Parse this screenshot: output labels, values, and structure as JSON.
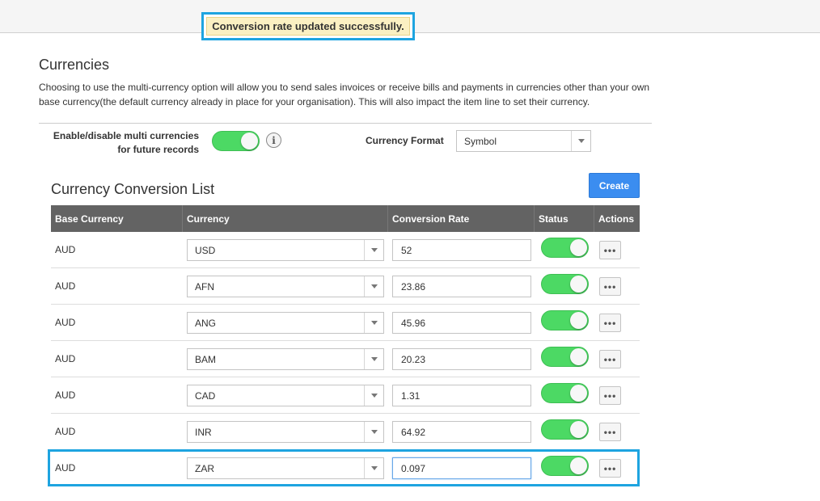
{
  "notification": {
    "message": "Conversion rate updated successfully."
  },
  "page": {
    "title": "Currencies",
    "description": "Choosing to use the multi-currency option will allow you to send sales invoices or receive bills and payments in currencies other than your own base currency(the default currency already in place for your organisation). This will also impact the item line to set their currency."
  },
  "options": {
    "multi_currency_label_line1": "Enable/disable multi currencies",
    "multi_currency_label_line2": "for future records",
    "multi_currency_enabled": true,
    "info_glyph": "i",
    "currency_format_label": "Currency Format",
    "currency_format_value": "Symbol"
  },
  "conversion_list": {
    "title": "Currency Conversion List",
    "create_label": "Create",
    "columns": {
      "base_currency": "Base Currency",
      "currency": "Currency",
      "conversion_rate": "Conversion Rate",
      "status": "Status",
      "actions": "Actions"
    },
    "rows": [
      {
        "base": "AUD",
        "currency": "USD",
        "rate": "52",
        "active": true
      },
      {
        "base": "AUD",
        "currency": "AFN",
        "rate": "23.86",
        "active": true
      },
      {
        "base": "AUD",
        "currency": "ANG",
        "rate": "45.96",
        "active": true
      },
      {
        "base": "AUD",
        "currency": "BAM",
        "rate": "20.23",
        "active": true
      },
      {
        "base": "AUD",
        "currency": "CAD",
        "rate": "1.31",
        "active": true
      },
      {
        "base": "AUD",
        "currency": "INR",
        "rate": "64.92",
        "active": true
      },
      {
        "base": "AUD",
        "currency": "ZAR",
        "rate": "0.097",
        "active": true
      }
    ],
    "actions_glyph": "•••"
  },
  "colors": {
    "toggle_on": "#4cd964",
    "header_bg": "#636363",
    "create_button": "#3b8df0",
    "highlight": "#1ea4e0",
    "toast_bg": "#fbf0c2"
  },
  "icons": {
    "info": "info-icon",
    "dropdown": "chevron-down-icon",
    "more": "more-horizontal-icon"
  }
}
